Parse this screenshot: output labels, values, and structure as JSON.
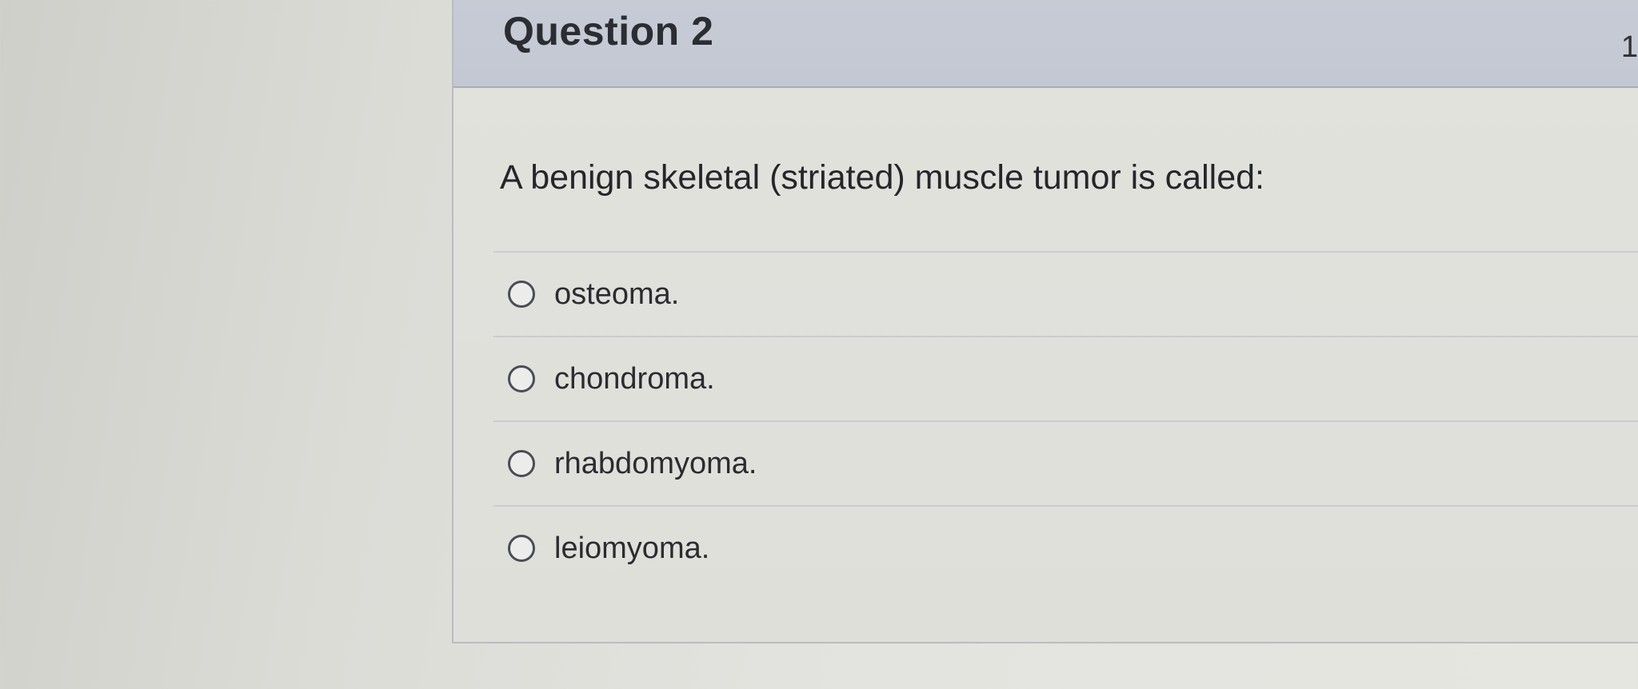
{
  "question": {
    "title": "Question 2",
    "points": "1",
    "prompt": "A benign skeletal (striated) muscle tumor is called:",
    "answers": [
      {
        "label": "osteoma."
      },
      {
        "label": "chondroma."
      },
      {
        "label": "rhabdomyoma."
      },
      {
        "label": "leiomyoma."
      }
    ]
  },
  "colors": {
    "header_background": "#c7cbd6",
    "card_background": "#e2e2dd",
    "text": "#2b2d33"
  }
}
